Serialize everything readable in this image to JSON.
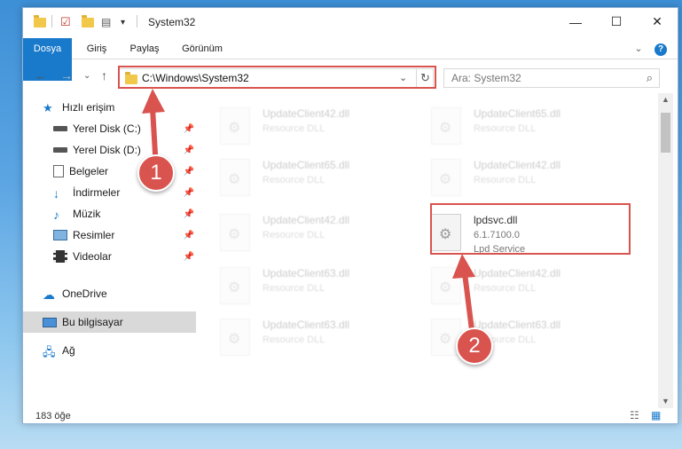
{
  "window": {
    "title": "System32",
    "controls": {
      "minimize": "—",
      "maximize": "☐",
      "close": "✕"
    }
  },
  "ribbon": {
    "tabs": [
      "Dosya",
      "Giriş",
      "Paylaş",
      "Görünüm"
    ]
  },
  "navigation": {
    "address": "C:\\Windows\\System32",
    "search_placeholder": "Ara: System32"
  },
  "sidebar": {
    "items": [
      {
        "label": "Hızlı erişim",
        "icon": "star-icon"
      },
      {
        "label": "Yerel Disk (C:)",
        "icon": "drive-icon",
        "pinned": true
      },
      {
        "label": "Yerel Disk (D:)",
        "icon": "drive-icon",
        "pinned": true
      },
      {
        "label": "Belgeler",
        "icon": "document-icon",
        "pinned": true
      },
      {
        "label": "İndirmeler",
        "icon": "download-icon",
        "pinned": true
      },
      {
        "label": "Müzik",
        "icon": "music-icon",
        "pinned": true
      },
      {
        "label": "Resimler",
        "icon": "picture-icon",
        "pinned": true
      },
      {
        "label": "Videolar",
        "icon": "video-icon",
        "pinned": true
      },
      {
        "label": "OneDrive",
        "icon": "cloud-icon"
      },
      {
        "label": "Bu bilgisayar",
        "icon": "computer-icon",
        "selected": true
      },
      {
        "label": "Ağ",
        "icon": "network-icon"
      }
    ]
  },
  "files": [
    {
      "name": "UpdateClient42.dll",
      "desc": "Resource DLL"
    },
    {
      "name": "UpdateClient65.dll",
      "desc": "Resource DLL"
    },
    {
      "name": "UpdateClient65.dll",
      "desc": "Resource DLL"
    },
    {
      "name": "UpdateClient42.dll",
      "desc": "Resource DLL"
    },
    {
      "name": "UpdateClient42.dll",
      "desc": "Resource DLL"
    },
    {
      "name": "lpdsvc.dll",
      "version": "6.1.7100.0",
      "desc": "Lpd Service",
      "highlighted": true
    },
    {
      "name": "UpdateClient63.dll",
      "desc": "Resource DLL"
    },
    {
      "name": "UpdateClient42.dll",
      "desc": "Resource DLL"
    },
    {
      "name": "UpdateClient63.dll",
      "desc": "Resource DLL"
    },
    {
      "name": "UpdateClient63.dll",
      "desc": "Resource DLL"
    }
  ],
  "status": {
    "item_count": "183 öğe"
  },
  "annotations": {
    "step1": "1",
    "step2": "2",
    "color": "#d9534f"
  }
}
